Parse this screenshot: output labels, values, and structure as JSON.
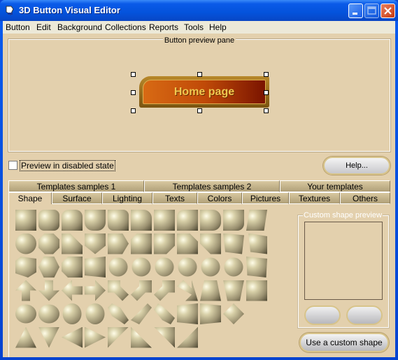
{
  "window": {
    "title": "3D Button Visual Editor"
  },
  "menu": [
    {
      "label": "Button",
      "accel": "B"
    },
    {
      "label": "Edit",
      "accel": "E"
    },
    {
      "label": "Background",
      "accel": "a"
    },
    {
      "label": "Collections",
      "accel": "C"
    },
    {
      "label": "Reports",
      "accel": "R"
    },
    {
      "label": "Tools",
      "accel": "T"
    },
    {
      "label": "Help",
      "accel": "H"
    }
  ],
  "preview": {
    "legend": "Button preview pane",
    "button_label": "Home page"
  },
  "disabled_preview": {
    "label": "Preview in disabled state",
    "checked": false
  },
  "help_button": "Help...",
  "tabs_row1": [
    "Templates samples 1",
    "Templates samples 2",
    "Your templates"
  ],
  "tabs_row2": [
    "Shape",
    "Surface",
    "Lighting",
    "Texts",
    "Colors",
    "Pictures",
    "Textures",
    "Others"
  ],
  "active_tab": "Shape",
  "custom_shape": {
    "legend": "Custom shape preview",
    "use_button": "Use a custom shape"
  },
  "shape_count": 59
}
